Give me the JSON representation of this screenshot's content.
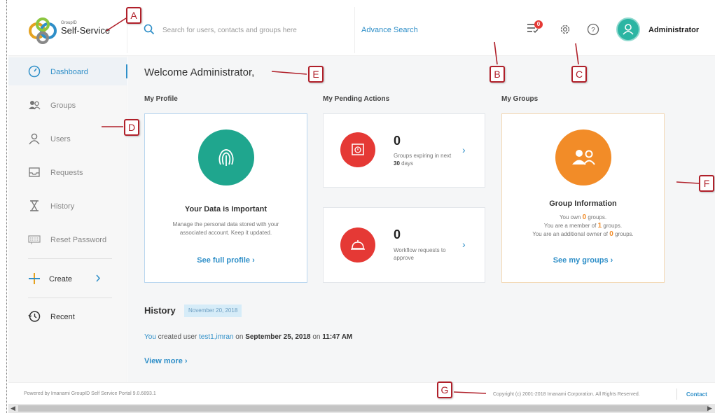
{
  "header": {
    "brand_small": "GroupID",
    "brand_big": "Self-Service",
    "search_placeholder": "Search for users, contacts and groups here",
    "advance_search": "Advance Search",
    "notification_count": "0",
    "user_name": "Administrator"
  },
  "sidebar": {
    "items": [
      {
        "label": "Dashboard",
        "icon": "dashboard-icon"
      },
      {
        "label": "Groups",
        "icon": "groups-icon"
      },
      {
        "label": "Users",
        "icon": "user-icon"
      },
      {
        "label": "Requests",
        "icon": "inbox-icon"
      },
      {
        "label": "History",
        "icon": "hourglass-icon"
      },
      {
        "label": "Reset Password",
        "icon": "keyboard-icon"
      },
      {
        "label": "Create",
        "icon": "plus-icon"
      },
      {
        "label": "Recent",
        "icon": "recent-icon"
      }
    ]
  },
  "main": {
    "welcome": "Welcome Administrator,",
    "profile": {
      "section_title": "My Profile",
      "title": "Your Data is Important",
      "desc": "Manage the personal data stored with your associated account. Keep it updated.",
      "link": "See full profile"
    },
    "pending": {
      "section_title": "My Pending Actions",
      "expiring": {
        "count": "0",
        "desc_prefix": "Groups expiring in next",
        "days": "30",
        "days_suffix": "days"
      },
      "workflow": {
        "count": "0",
        "desc": "Workflow requests to approve"
      }
    },
    "groups": {
      "section_title": "My Groups",
      "title": "Group Information",
      "own_prefix": "You own",
      "own_count": "0",
      "own_suffix": "groups.",
      "member_prefix": "You are a member of",
      "member_count": "1",
      "member_suffix": "groups.",
      "owner_prefix": "You are an additional owner of",
      "owner_count": "0",
      "owner_suffix": "groups.",
      "link": "See my groups"
    },
    "history": {
      "title": "History",
      "date": "November 20, 2018",
      "entry_actor": "You",
      "entry_action": "created user",
      "entry_target": "test1,imran",
      "entry_on": "on",
      "entry_date": "September 25, 2018",
      "entry_on2": "on",
      "entry_time": "11:47 AM",
      "view_more": "View more"
    }
  },
  "footer": {
    "powered": "Powered by Imanami GroupID Self Service Portal 9.0.6893.1",
    "copyright": "Copyright (c) 2001-2018 Imanami Corporation. All Rights Reserved.",
    "contact": "Contact"
  },
  "callouts": [
    "A",
    "B",
    "C",
    "D",
    "E",
    "F",
    "G"
  ],
  "colors": {
    "accent": "#2f8fc8",
    "profile_circle": "#1fa68e",
    "pending_circle": "#e53935",
    "groups_circle": "#f28c28",
    "callout": "#b0202a"
  }
}
